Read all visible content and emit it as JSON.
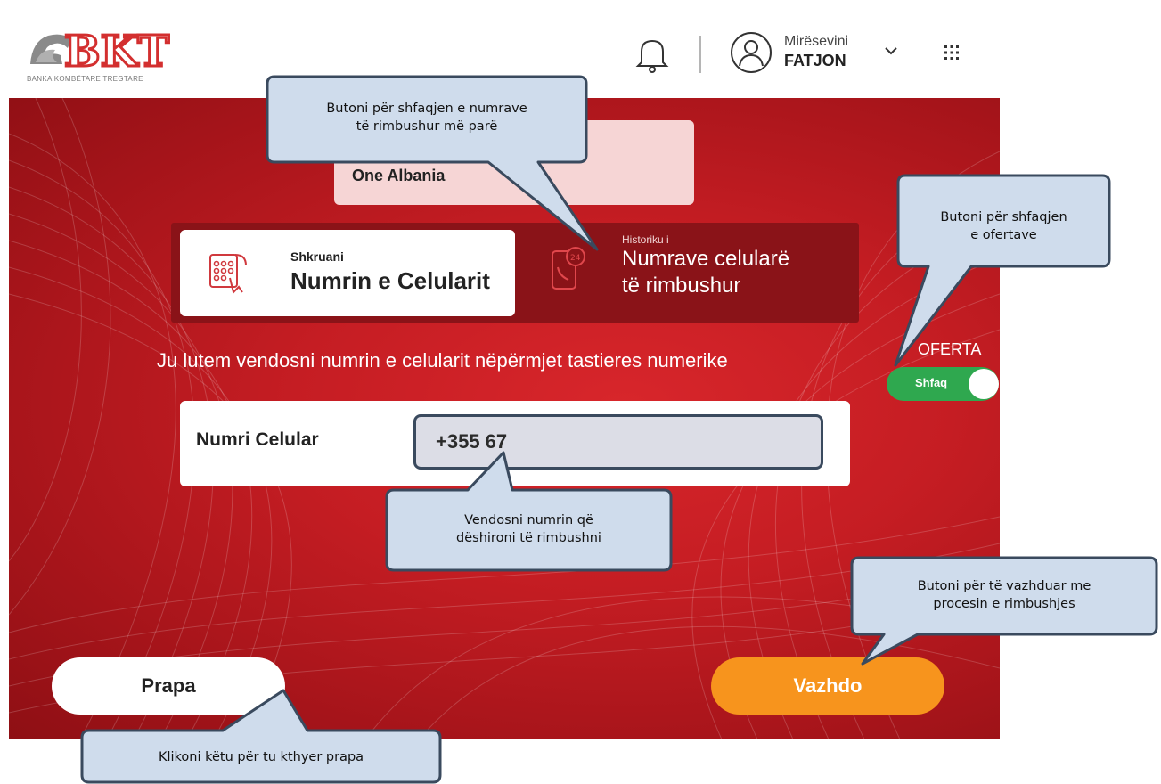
{
  "header": {
    "logo_text": "BKT",
    "logo_sub": "BANKA KOMBËTARE TREGTARE",
    "greeting": "Mirësevini",
    "user_name": "FATJON"
  },
  "operator": {
    "name": "One Albania"
  },
  "tabs": {
    "enter": {
      "small": "Shkruani",
      "big": "Numrin e Celularit"
    },
    "history": {
      "small": "Historiku i",
      "big_line1": "Numrave celularë",
      "big_line2": "të rimbushur"
    }
  },
  "instruction": "Ju lutem vendosni numrin e celularit nëpërmjet tastieres numerike",
  "offer": {
    "label": "OFERTA",
    "toggle_label": "Shfaq",
    "enabled": true
  },
  "phone": {
    "label": "Numri Celular",
    "value": "+355 67"
  },
  "buttons": {
    "back": "Prapa",
    "next": "Vazhdo"
  },
  "callouts": {
    "history": {
      "line1": "Butoni për shfaqjen e numrave",
      "line2": "të rimbushur më parë"
    },
    "offer": {
      "line1": "Butoni për shfaqjen",
      "line2": "e ofertave"
    },
    "phone": {
      "line1": "Vendosni numrin që",
      "line2": "dëshironi të rimbushni"
    },
    "next": {
      "line1": "Butoni për të vazhduar me",
      "line2": "procesin e rimbushjes"
    },
    "back": {
      "line1": "Klikoni këtu për tu kthyer prapa"
    }
  },
  "colors": {
    "brand_red": "#c51d23",
    "accent_orange": "#f7941d",
    "toggle_green": "#2fa84f",
    "callout_fill": "#cfdcec",
    "callout_border": "#3a4a5e"
  },
  "icons": [
    "bell-icon",
    "user-avatar-icon",
    "chevron-down-icon",
    "apps-grid-icon",
    "keypad-phone-icon",
    "phone-history-icon"
  ]
}
